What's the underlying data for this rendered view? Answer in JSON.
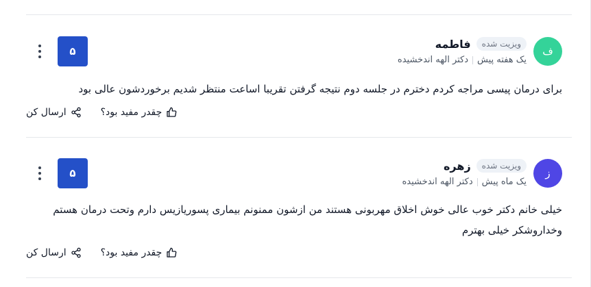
{
  "reviews": [
    {
      "avatar_letter": "ف",
      "avatar_color": "#34d399",
      "name": "فاطمه",
      "badge": "ویزیت شده",
      "time": "یک هفته پیش",
      "doctor": "دکتر الهه اندخشیده",
      "score": "۵",
      "text": "برای درمان پیسی مراجه کردم دخترم در جلسه دوم نتیجه گرفتن تقریبا اساعت منتظر شدیم برخوردشون عالی بود",
      "helpful_label": "چقدر مفید بود؟",
      "send_label": "ارسال کن"
    },
    {
      "avatar_letter": "ز",
      "avatar_color": "#4f46e5",
      "name": "زهره",
      "badge": "ویزیت شده",
      "time": "یک ماه پیش",
      "doctor": "دکتر الهه اندخشیده",
      "score": "۵",
      "text": "خیلی خانم دکتر خوب عالی خوش اخلاق مهربونی هستند من ازشون ممنونم بیماری پسوریازیس دارم وتحت درمان هستم وخداروشکر خیلی بهترم",
      "helpful_label": "چقدر مفید بود؟",
      "send_label": "ارسال کن"
    }
  ]
}
